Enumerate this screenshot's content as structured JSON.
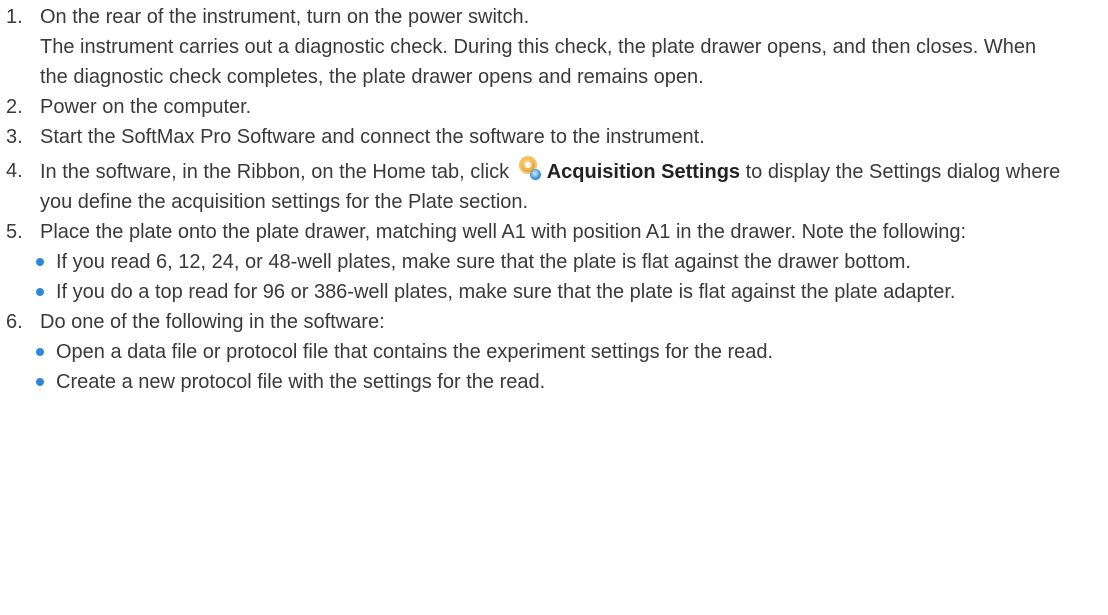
{
  "steps": [
    {
      "num": "1.",
      "text": "On the rear of the instrument, turn on the power switch.",
      "note": "The instrument carries out a diagnostic check. During this check, the plate drawer opens, and then closes. When the diagnostic check completes, the plate drawer opens and remains open."
    },
    {
      "num": "2.",
      "text": "Power on the computer."
    },
    {
      "num": "3.",
      "text": "Start the SoftMax Pro Software and connect the software to the instrument."
    },
    {
      "num": "4.",
      "text_before": "In the software, in the Ribbon, on the Home tab, click",
      "icon": "acquisition-settings-icon",
      "ui_label": "Acquisition Settings",
      "text_after": "to display the Settings dialog where you define the acquisition settings for the Plate section."
    },
    {
      "num": "5.",
      "text": "Place the plate onto the plate drawer, matching well A1 with position A1 in the drawer. Note the following:",
      "bullets": [
        "If you read 6, 12, 24, or 48-well plates, make sure that the plate is flat against the drawer bottom.",
        "If you do a top read for 96 or 386-well plates, make sure that the plate is flat against the plate adapter."
      ]
    },
    {
      "num": "6.",
      "text": "Do one of the following in the software:",
      "bullets": [
        "Open a data file or protocol file that contains the experiment settings for the read.",
        "Create a new protocol file with the settings for the read."
      ]
    }
  ],
  "colors": {
    "text": "#3a3a3a",
    "bullet": "#2d88d6",
    "icon_primary": "#e9a531",
    "icon_secondary": "#3a8fd9"
  }
}
